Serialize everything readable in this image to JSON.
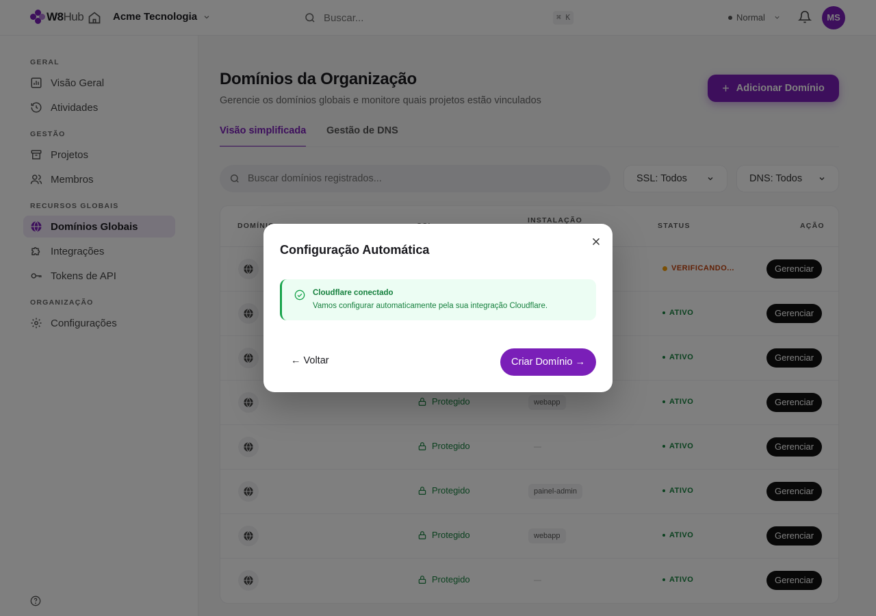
{
  "header": {
    "logo_prefix": "W8",
    "logo_suffix": "Hub",
    "org_name": "Acme Tecnologia",
    "search_placeholder": "Buscar...",
    "shortcut": "⌘ K",
    "mode_label": "Normal",
    "avatar_initials": "MS"
  },
  "sidebar": {
    "sections": [
      {
        "label": "GERAL",
        "items": [
          "Visão Geral",
          "Atividades"
        ]
      },
      {
        "label": "GESTÃO",
        "items": [
          "Projetos",
          "Membros"
        ]
      },
      {
        "label": "RECURSOS GLOBAIS",
        "items": [
          "Domínios Globais",
          "Integrações",
          "Tokens de API"
        ]
      },
      {
        "label": "ORGANIZAÇÃO",
        "items": [
          "Configurações"
        ]
      }
    ],
    "active_item": "Domínios Globais"
  },
  "main": {
    "title": "Domínios da Organização",
    "subtitle": "Gerencie os domínios globais e monitore quais projetos estão vinculados",
    "add_button": "Adicionar Domínio",
    "tabs": [
      "Visão simplificada",
      "Gestão de DNS"
    ],
    "search_placeholder": "Buscar domínios registrados...",
    "ssl_filter": "SSL: Todos",
    "dns_filter": "DNS: Todos",
    "table": {
      "headers": [
        "DOMÍNIO",
        "SSL",
        "INSTALAÇÃO",
        "STATUS",
        "AÇÃO"
      ],
      "rows": [
        {
          "ssl": "",
          "installation": "",
          "status": "VERIFICANDO...",
          "action": "Gerenciar"
        },
        {
          "ssl": "",
          "installation": "",
          "status": "ATIVO",
          "action": "Gerenciar"
        },
        {
          "ssl": "",
          "installation": "",
          "status": "ATIVO",
          "action": "Gerenciar"
        },
        {
          "ssl": "Protegido",
          "installation": "webapp",
          "status": "ATIVO",
          "action": "Gerenciar"
        },
        {
          "ssl": "Protegido",
          "installation": "—",
          "status": "ATIVO",
          "action": "Gerenciar"
        },
        {
          "ssl": "Protegido",
          "installation": "painel-admin",
          "status": "ATIVO",
          "action": "Gerenciar"
        },
        {
          "ssl": "Protegido",
          "installation": "webapp",
          "status": "ATIVO",
          "action": "Gerenciar"
        },
        {
          "ssl": "Protegido",
          "installation": "—",
          "status": "ATIVO",
          "action": "Gerenciar"
        }
      ]
    }
  },
  "modal": {
    "title": "Configuração Automática",
    "alert_title": "Cloudflare conectado",
    "alert_text": "Vamos configurar automaticamente pela sua integração Cloudflare.",
    "back_button": "← Voltar",
    "create_button": "Criar Domínio →"
  },
  "colors": {
    "brand": "#7a1fb8",
    "success": "#15803d",
    "warning": "#c2410c"
  }
}
